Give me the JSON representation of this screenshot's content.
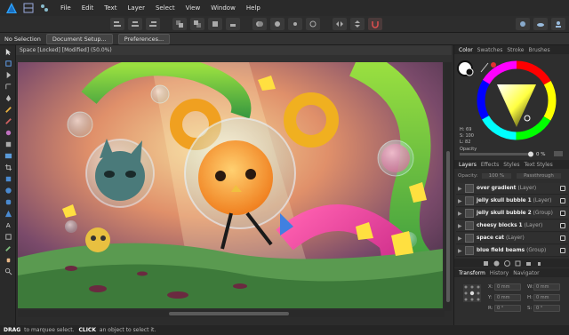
{
  "menu": {
    "items": [
      "File",
      "Edit",
      "Text",
      "Layer",
      "Select",
      "View",
      "Window",
      "Help"
    ]
  },
  "context": {
    "selection": "No Selection",
    "document_setup": "Document Setup...",
    "preferences": "Preferences..."
  },
  "document": {
    "tab_title": "Space [Locked] [Modified] (50.0%)"
  },
  "status": {
    "drag_key": "DRAG",
    "drag_text": "to marquee select.",
    "click_key": "CLICK",
    "click_text": "an object to select it."
  },
  "color_panel": {
    "tabs": [
      "Color",
      "Swatches",
      "Stroke",
      "Brushes"
    ],
    "hsl_h": "H: 69",
    "hsl_s": "S: 100",
    "hsl_l": "L: 82",
    "opacity_label": "Opacity",
    "opacity_value": "0 %",
    "accent": "#ffff00"
  },
  "layers_panel": {
    "tabs": [
      "Layers",
      "Effects",
      "Styles",
      "Text Styles"
    ],
    "opacity_label": "Opacity:",
    "opacity_value": "100 %",
    "blend_mode": "Passthrough",
    "layers": [
      {
        "name": "over gradient",
        "type": "(Layer)"
      },
      {
        "name": "jelly skull bubble 1",
        "type": "(Layer)"
      },
      {
        "name": "jelly skull bubble 2",
        "type": "(Group)"
      },
      {
        "name": "cheesy blocks 1",
        "type": "(Layer)"
      },
      {
        "name": "space cat",
        "type": "(Layer)"
      },
      {
        "name": "blue field beams",
        "type": "(Group)"
      }
    ]
  },
  "transform_panel": {
    "tabs": [
      "Transform",
      "History",
      "Navigator"
    ],
    "x_label": "X:",
    "x_value": "0 mm",
    "y_label": "Y:",
    "y_value": "0 mm",
    "w_label": "W:",
    "w_value": "0 mm",
    "h_label": "H:",
    "h_value": "0 mm",
    "r_label": "R:",
    "r_value": "0 °",
    "s_label": "S:",
    "s_value": "0 °"
  }
}
